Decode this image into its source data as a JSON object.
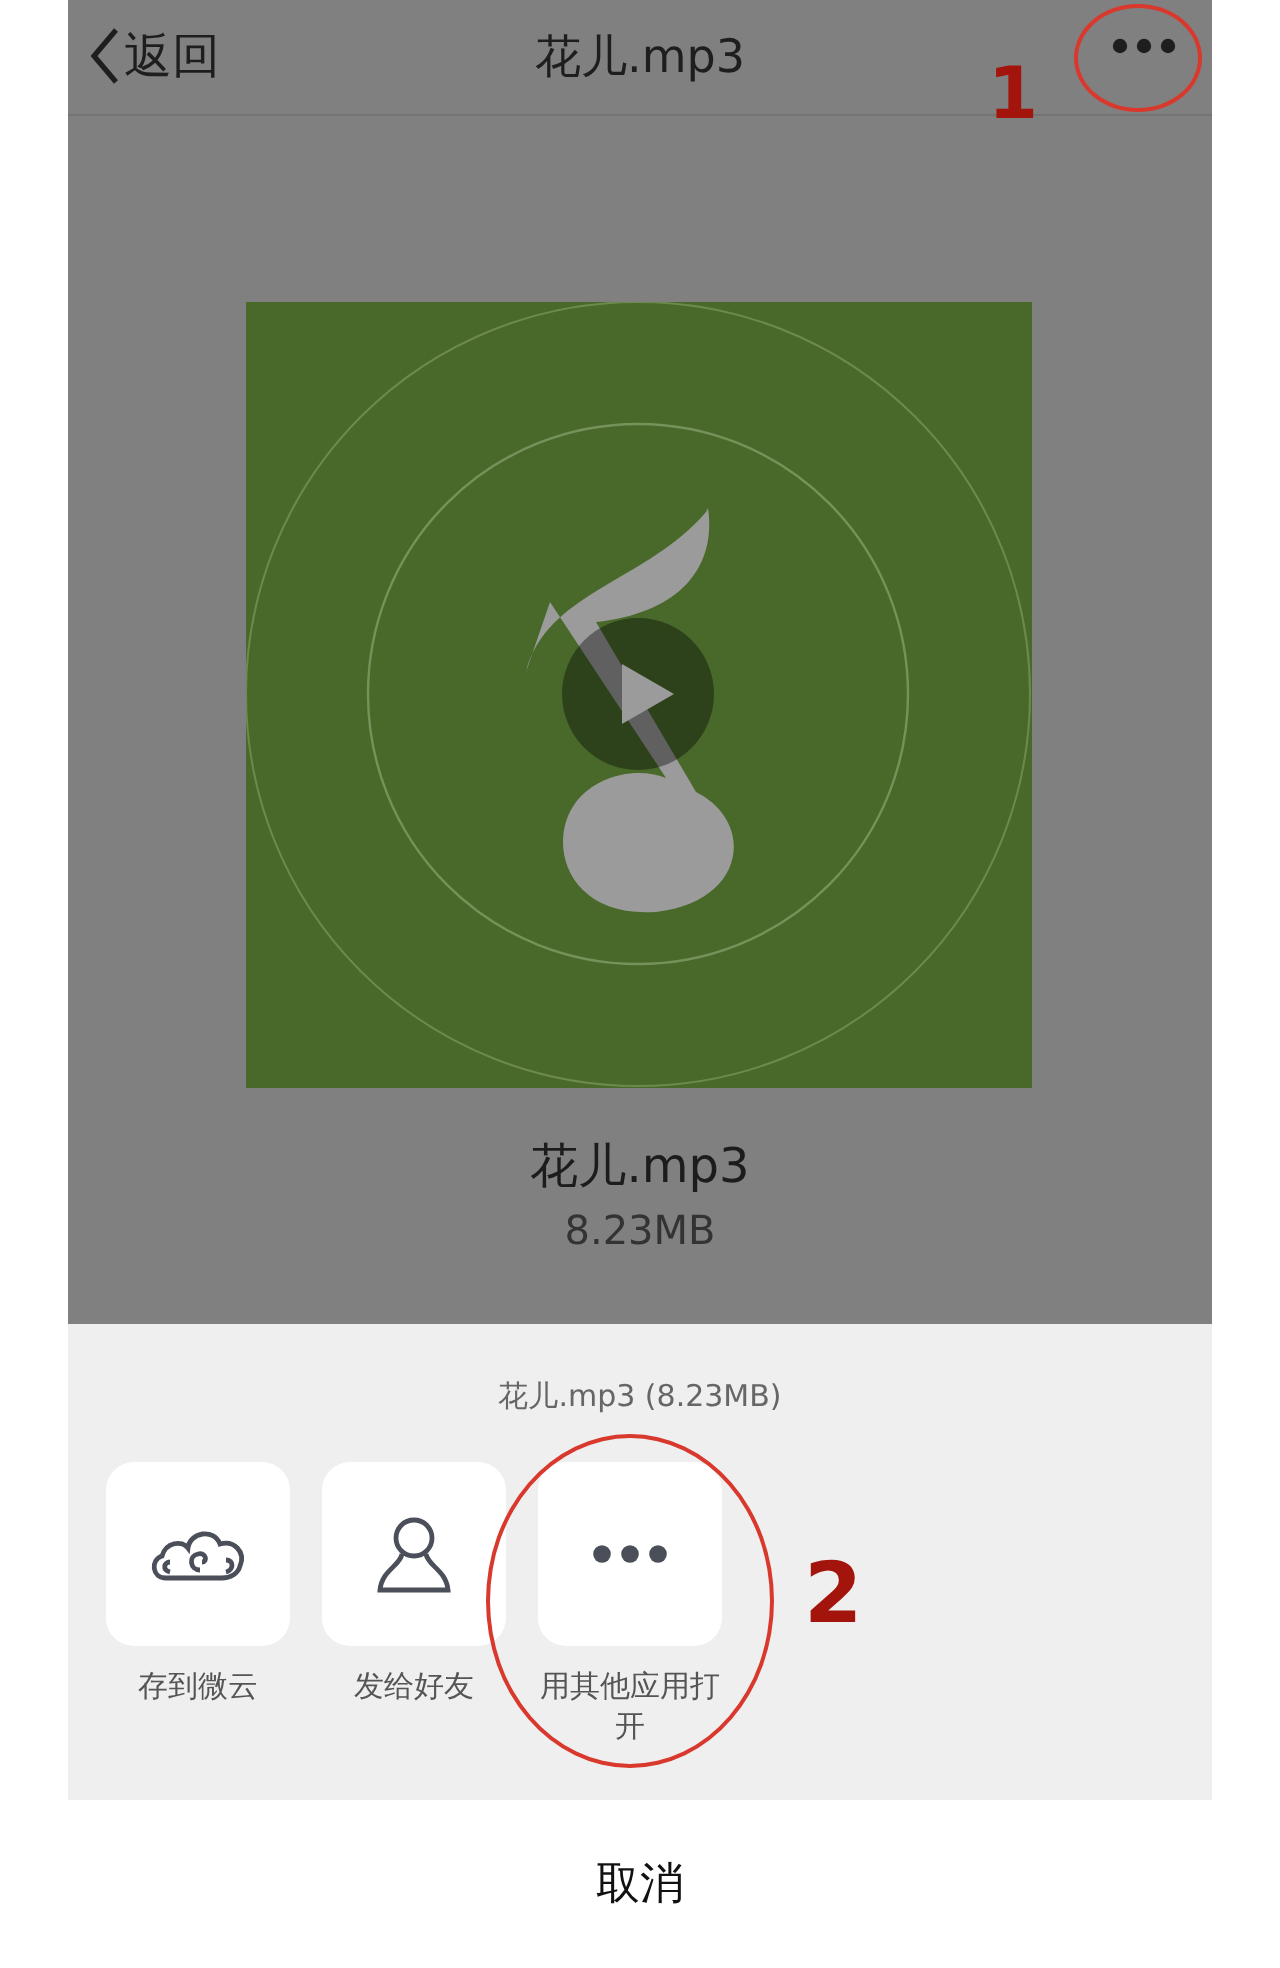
{
  "nav_bar": {
    "back_label": "返回",
    "title": "花儿.mp3"
  },
  "file": {
    "name": "花儿.mp3",
    "size": "8.23MB"
  },
  "share_sheet": {
    "caption": "花儿.mp3 (8.23MB)",
    "actions": [
      {
        "kind": "cloud",
        "label": "存到微云"
      },
      {
        "kind": "friend",
        "label": "发给好友"
      },
      {
        "kind": "more",
        "label": "用其他应用打开"
      }
    ],
    "cancel": "取消"
  },
  "annotations": [
    {
      "label": "1"
    },
    {
      "label": "2"
    }
  ]
}
